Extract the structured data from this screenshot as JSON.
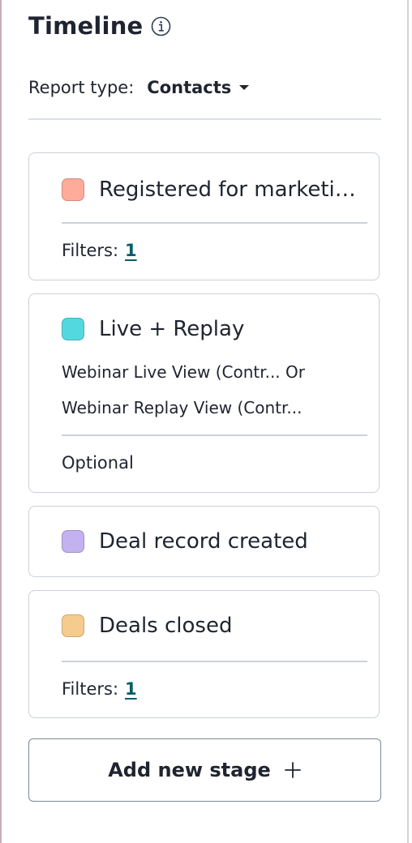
{
  "header": {
    "title": "Timeline",
    "info_icon": "info-circle-icon"
  },
  "report": {
    "label": "Report type:",
    "value": "Contacts",
    "caret_icon": "caret-down-icon"
  },
  "stages": [
    {
      "name": "Registered for marketin...",
      "color": "#ffab99",
      "filters_label": "Filters:",
      "filters_count": "1"
    },
    {
      "name": "Live + Replay",
      "color": "#54d8e0",
      "condition_1": "Webinar Live View (Contr... Or",
      "condition_2": "Webinar Replay View (Contr...",
      "footer": "Optional"
    },
    {
      "name": "Deal record created",
      "color": "#c4b1f0"
    },
    {
      "name": "Deals closed",
      "color": "#f6cb8e",
      "filters_label": "Filters:",
      "filters_count": "1"
    }
  ],
  "add_stage": {
    "label": "Add new stage",
    "icon": "plus-icon"
  }
}
